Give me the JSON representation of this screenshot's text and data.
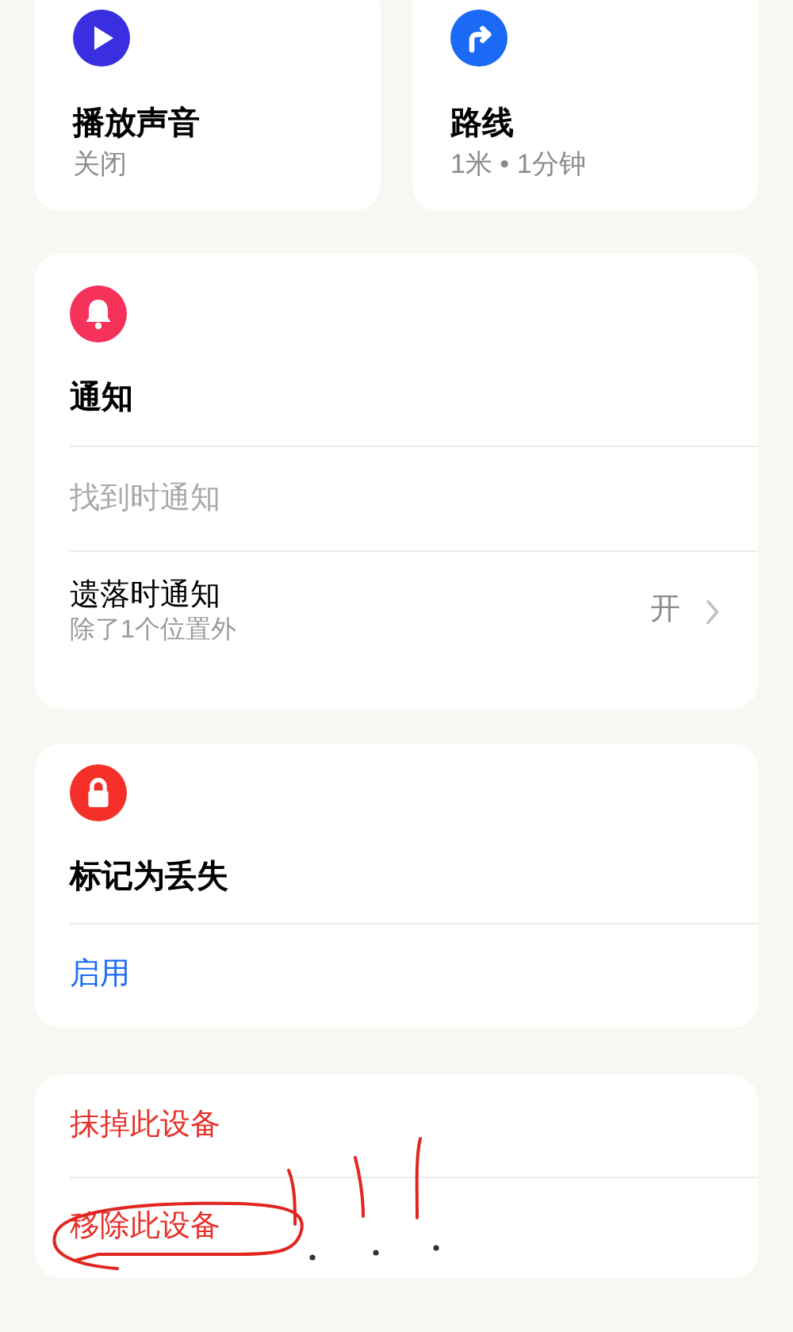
{
  "top_cards": [
    {
      "kind": "sound",
      "title": "播放声音",
      "subtitle": "关闭"
    },
    {
      "kind": "directions",
      "title": "路线",
      "subtitle": "1米 • 1分钟"
    }
  ],
  "notifications": {
    "title": "通知",
    "rows": [
      {
        "label": "找到时通知",
        "disabled": true
      },
      {
        "label": "遗落时通知",
        "subtitle": "除了1个位置外",
        "value": "开",
        "disabled": false
      }
    ]
  },
  "lost_mode": {
    "title": "标记为丢失",
    "action": "启用"
  },
  "device_actions": [
    {
      "label": "抹掉此设备"
    },
    {
      "label": "移除此设备"
    }
  ]
}
